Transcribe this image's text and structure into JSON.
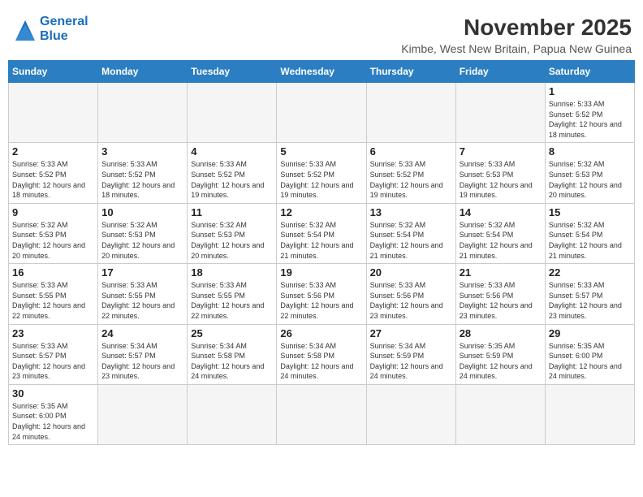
{
  "header": {
    "logo_general": "General",
    "logo_blue": "Blue",
    "month": "November 2025",
    "location": "Kimbe, West New Britain, Papua New Guinea"
  },
  "days_of_week": [
    "Sunday",
    "Monday",
    "Tuesday",
    "Wednesday",
    "Thursday",
    "Friday",
    "Saturday"
  ],
  "weeks": [
    [
      null,
      null,
      null,
      null,
      null,
      null,
      {
        "day": 1,
        "sunrise": "5:33 AM",
        "sunset": "5:52 PM",
        "daylight": "12 hours and 18 minutes."
      }
    ],
    [
      {
        "day": 2,
        "sunrise": "5:33 AM",
        "sunset": "5:52 PM",
        "daylight": "12 hours and 18 minutes."
      },
      {
        "day": 3,
        "sunrise": "5:33 AM",
        "sunset": "5:52 PM",
        "daylight": "12 hours and 18 minutes."
      },
      {
        "day": 4,
        "sunrise": "5:33 AM",
        "sunset": "5:52 PM",
        "daylight": "12 hours and 19 minutes."
      },
      {
        "day": 5,
        "sunrise": "5:33 AM",
        "sunset": "5:52 PM",
        "daylight": "12 hours and 19 minutes."
      },
      {
        "day": 6,
        "sunrise": "5:33 AM",
        "sunset": "5:52 PM",
        "daylight": "12 hours and 19 minutes."
      },
      {
        "day": 7,
        "sunrise": "5:33 AM",
        "sunset": "5:53 PM",
        "daylight": "12 hours and 19 minutes."
      },
      {
        "day": 8,
        "sunrise": "5:32 AM",
        "sunset": "5:53 PM",
        "daylight": "12 hours and 20 minutes."
      }
    ],
    [
      {
        "day": 9,
        "sunrise": "5:32 AM",
        "sunset": "5:53 PM",
        "daylight": "12 hours and 20 minutes."
      },
      {
        "day": 10,
        "sunrise": "5:32 AM",
        "sunset": "5:53 PM",
        "daylight": "12 hours and 20 minutes."
      },
      {
        "day": 11,
        "sunrise": "5:32 AM",
        "sunset": "5:53 PM",
        "daylight": "12 hours and 20 minutes."
      },
      {
        "day": 12,
        "sunrise": "5:32 AM",
        "sunset": "5:54 PM",
        "daylight": "12 hours and 21 minutes."
      },
      {
        "day": 13,
        "sunrise": "5:32 AM",
        "sunset": "5:54 PM",
        "daylight": "12 hours and 21 minutes."
      },
      {
        "day": 14,
        "sunrise": "5:32 AM",
        "sunset": "5:54 PM",
        "daylight": "12 hours and 21 minutes."
      },
      {
        "day": 15,
        "sunrise": "5:32 AM",
        "sunset": "5:54 PM",
        "daylight": "12 hours and 21 minutes."
      }
    ],
    [
      {
        "day": 16,
        "sunrise": "5:33 AM",
        "sunset": "5:55 PM",
        "daylight": "12 hours and 22 minutes."
      },
      {
        "day": 17,
        "sunrise": "5:33 AM",
        "sunset": "5:55 PM",
        "daylight": "12 hours and 22 minutes."
      },
      {
        "day": 18,
        "sunrise": "5:33 AM",
        "sunset": "5:55 PM",
        "daylight": "12 hours and 22 minutes."
      },
      {
        "day": 19,
        "sunrise": "5:33 AM",
        "sunset": "5:56 PM",
        "daylight": "12 hours and 22 minutes."
      },
      {
        "day": 20,
        "sunrise": "5:33 AM",
        "sunset": "5:56 PM",
        "daylight": "12 hours and 23 minutes."
      },
      {
        "day": 21,
        "sunrise": "5:33 AM",
        "sunset": "5:56 PM",
        "daylight": "12 hours and 23 minutes."
      },
      {
        "day": 22,
        "sunrise": "5:33 AM",
        "sunset": "5:57 PM",
        "daylight": "12 hours and 23 minutes."
      }
    ],
    [
      {
        "day": 23,
        "sunrise": "5:33 AM",
        "sunset": "5:57 PM",
        "daylight": "12 hours and 23 minutes."
      },
      {
        "day": 24,
        "sunrise": "5:34 AM",
        "sunset": "5:57 PM",
        "daylight": "12 hours and 23 minutes."
      },
      {
        "day": 25,
        "sunrise": "5:34 AM",
        "sunset": "5:58 PM",
        "daylight": "12 hours and 24 minutes."
      },
      {
        "day": 26,
        "sunrise": "5:34 AM",
        "sunset": "5:58 PM",
        "daylight": "12 hours and 24 minutes."
      },
      {
        "day": 27,
        "sunrise": "5:34 AM",
        "sunset": "5:59 PM",
        "daylight": "12 hours and 24 minutes."
      },
      {
        "day": 28,
        "sunrise": "5:35 AM",
        "sunset": "5:59 PM",
        "daylight": "12 hours and 24 minutes."
      },
      {
        "day": 29,
        "sunrise": "5:35 AM",
        "sunset": "6:00 PM",
        "daylight": "12 hours and 24 minutes."
      }
    ],
    [
      {
        "day": 30,
        "sunrise": "5:35 AM",
        "sunset": "6:00 PM",
        "daylight": "12 hours and 24 minutes."
      },
      null,
      null,
      null,
      null,
      null,
      null
    ]
  ]
}
